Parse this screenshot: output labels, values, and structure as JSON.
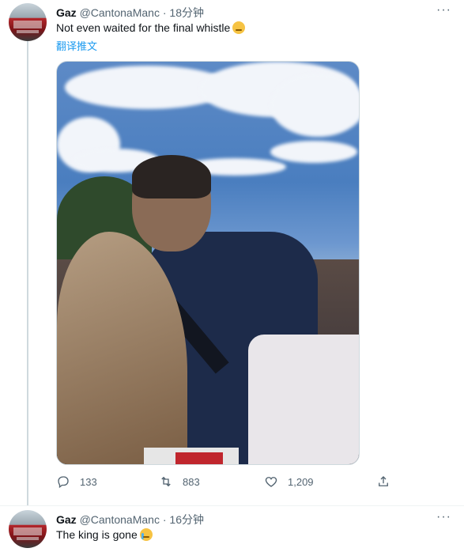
{
  "tweets": [
    {
      "author": {
        "name": "Gaz",
        "handle": "@CantonaManc",
        "dot": "·",
        "time": "18分钟"
      },
      "text": "Not even waited for the final whistle",
      "emoji": "pensive-face-emoji",
      "translate_label": "翻译推文",
      "media_alt": "",
      "stats": {
        "replies": "133",
        "retweets": "883",
        "likes": "1,209"
      }
    },
    {
      "author": {
        "name": "Gaz",
        "handle": "@CantonaManc",
        "dot": "·",
        "time": "16分钟"
      },
      "text": "The king is gone",
      "emoji": "crying-face-emoji"
    }
  ],
  "colors": {
    "text_primary": "#0f1419",
    "text_secondary": "#536471",
    "link": "#1d9bf0",
    "thread_line": "#cfd9de"
  },
  "icons": [
    "more-options-icon",
    "reply-icon",
    "retweet-icon",
    "like-icon",
    "share-icon"
  ]
}
